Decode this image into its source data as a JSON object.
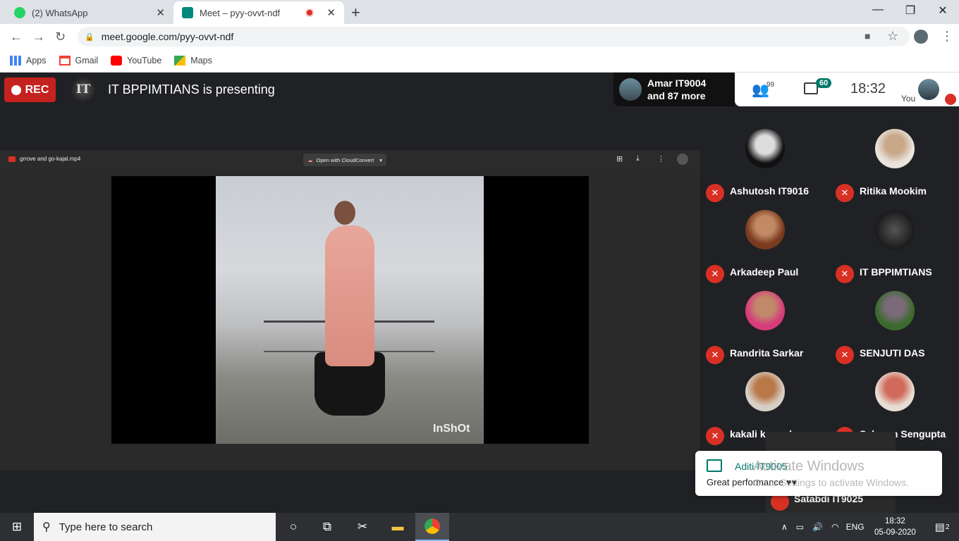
{
  "browser": {
    "tabs": [
      {
        "title": "(2) WhatsApp",
        "active": false,
        "favicon": "whatsapp-icon"
      },
      {
        "title": "Meet – pyy-ovvt-ndf",
        "active": true,
        "favicon": "google-meet-icon",
        "recording": true
      }
    ],
    "url": "meet.google.com/pyy-ovvt-ndf",
    "bookmarks": [
      {
        "label": "Apps",
        "icon": "apps-grid-icon"
      },
      {
        "label": "Gmail",
        "icon": "gmail-icon"
      },
      {
        "label": "YouTube",
        "icon": "youtube-icon"
      },
      {
        "label": "Maps",
        "icon": "maps-icon"
      }
    ]
  },
  "meet": {
    "rec_label": "REC",
    "presenter_logo": "IT",
    "presenting_text": "IT BPPIMTIANS is presenting",
    "notification": {
      "line1": "Amar IT9004",
      "line2": "and 87 more"
    },
    "participants_badge": "99",
    "chat_count": "60",
    "time": "18:32",
    "self_label": "You",
    "presentation": {
      "file_name": "grrove and go-kajal.mp4",
      "open_with": "Open with CloudConvert",
      "watermark": "InShOt"
    },
    "participants": [
      {
        "name": "Ashutosh IT9016",
        "muted": true
      },
      {
        "name": "Ritika Mookim",
        "muted": true
      },
      {
        "name": "Arkadeep Paul",
        "muted": true
      },
      {
        "name": "IT BPPIMTIANS",
        "muted": true
      },
      {
        "name": "Randrita Sarkar",
        "muted": true
      },
      {
        "name": "SENJUTI DAS",
        "muted": true
      },
      {
        "name": "kakali karmakarsur",
        "muted": true
      },
      {
        "name": "Sabnam Sengupta",
        "muted": true
      }
    ],
    "peek_participant": "Satabdi IT9025",
    "chat_toast": {
      "sender": "Aditi IT9005",
      "message": "Great performance ♥♥"
    }
  },
  "windows": {
    "activate_title": "Activate Windows",
    "activate_sub": "Go to Settings to activate Windows.",
    "search_placeholder": "Type here to search",
    "language": "ENG",
    "clock_time": "18:32",
    "clock_date": "05-09-2020",
    "notifications_count": "2"
  }
}
